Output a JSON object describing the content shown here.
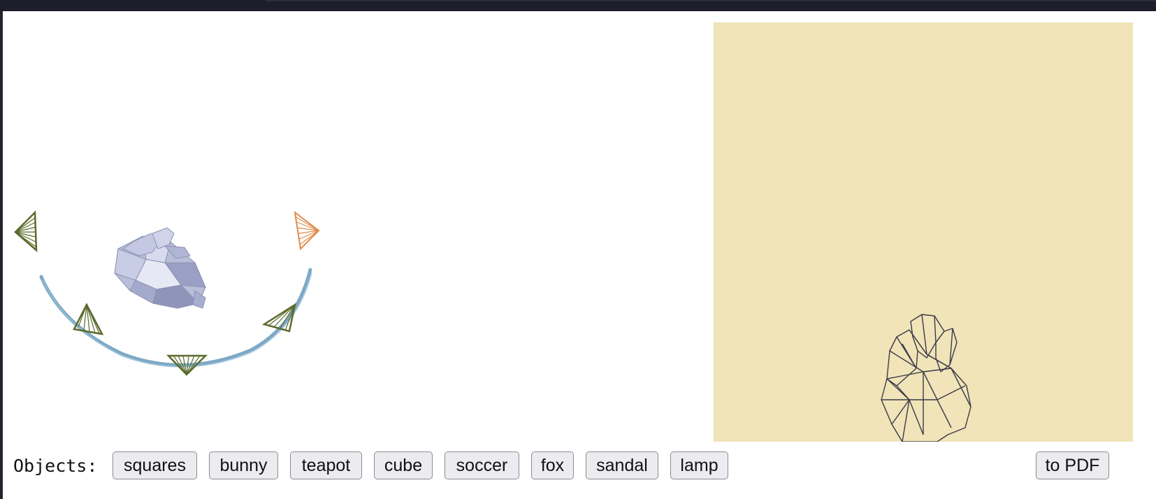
{
  "controls": {
    "objects_label": "Objects:",
    "buttons": [
      "squares",
      "bunny",
      "teapot",
      "cube",
      "soccer",
      "fox",
      "sandal",
      "lamp"
    ],
    "pdf_label": "to PDF"
  },
  "scene": {
    "camera_path_color": "#6fa0c0",
    "camera_color": "#5b6a2c",
    "active_camera_color": "#e08c4c",
    "model_color": "#aab0d0"
  },
  "render": {
    "background_color": "#f0e4b8",
    "wire_color": "#3a3a4a"
  }
}
